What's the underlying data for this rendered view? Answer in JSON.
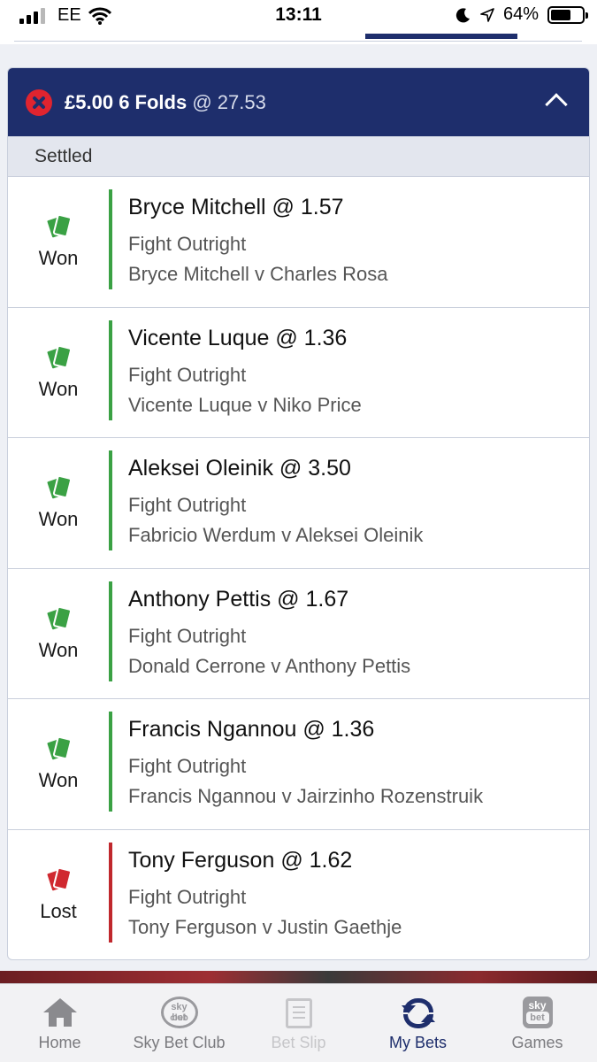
{
  "status_bar": {
    "carrier": "EE",
    "time": "13:11",
    "battery_percent": "64%",
    "battery_level": 0.64
  },
  "bet": {
    "stake": "£5.00",
    "bet_type": "6 Folds",
    "odds": "@ 27.53",
    "status": "Settled",
    "colors": {
      "header": "#1e2e6c",
      "won": "#3aa144",
      "lost": "#c0282d"
    },
    "selections": [
      {
        "result": "Won",
        "name": "Bryce Mitchell @ 1.57",
        "market": "Fight Outright",
        "event": "Bryce Mitchell v Charles Rosa"
      },
      {
        "result": "Won",
        "name": "Vicente Luque @ 1.36",
        "market": "Fight Outright",
        "event": "Vicente Luque v Niko Price"
      },
      {
        "result": "Won",
        "name": "Aleksei Oleinik @ 3.50",
        "market": "Fight Outright",
        "event": "Fabricio Werdum v Aleksei Oleinik"
      },
      {
        "result": "Won",
        "name": "Anthony Pettis @ 1.67",
        "market": "Fight Outright",
        "event": "Donald Cerrone v Anthony Pettis"
      },
      {
        "result": "Won",
        "name": "Francis Ngannou @ 1.36",
        "market": "Fight Outright",
        "event": "Francis Ngannou v Jairzinho Rozenstruik"
      },
      {
        "result": "Lost",
        "name": "Tony Ferguson @ 1.62",
        "market": "Fight Outright",
        "event": "Tony Ferguson v Justin Gaethje"
      }
    ]
  },
  "nav": {
    "items": [
      {
        "label": "Home",
        "icon": "home-icon"
      },
      {
        "label": "Sky Bet Club",
        "icon": "club-icon",
        "icon_text": [
          "sky bet",
          "club"
        ]
      },
      {
        "label": "Bet Slip",
        "icon": "bet-slip-icon"
      },
      {
        "label": "My Bets",
        "icon": "my-bets-icon",
        "active": true
      },
      {
        "label": "Games",
        "icon": "games-icon",
        "icon_text": [
          "sky",
          "bet"
        ]
      }
    ]
  }
}
